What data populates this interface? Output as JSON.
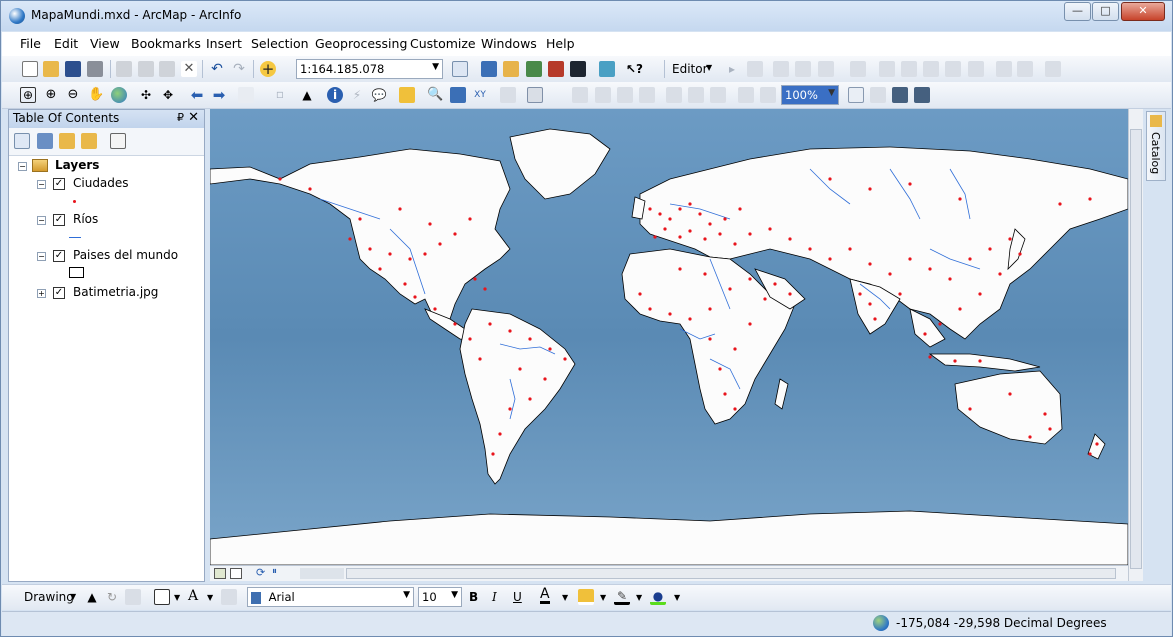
{
  "window": {
    "title": "MapaMundi.mxd - ArcMap - ArcInfo",
    "min": "—",
    "max": "□",
    "close": "✕"
  },
  "menu": [
    "File",
    "Edit",
    "View",
    "Bookmarks",
    "Insert",
    "Selection",
    "Geoprocessing",
    "Customize",
    "Windows",
    "Help"
  ],
  "standard_toolbar": {
    "scale_value": "1:164.185.078",
    "editor_label": "Editor"
  },
  "tools_toolbar": {
    "zoom_percent": "100%"
  },
  "toc": {
    "title": "Table Of Contents",
    "pin": "₽",
    "close": "✕",
    "root": "Layers",
    "layers": [
      {
        "name": "Ciudades",
        "expanded": true,
        "checked": true,
        "symbol": "point-red"
      },
      {
        "name": "Ríos",
        "expanded": true,
        "checked": true,
        "symbol": "line-blue"
      },
      {
        "name": "Paises del mundo",
        "expanded": true,
        "checked": true,
        "symbol": "polygon-white"
      },
      {
        "name": "Batimetria.jpg",
        "expanded": false,
        "checked": true,
        "symbol": "raster"
      }
    ]
  },
  "catalog_tab": "Catalog",
  "drawing_toolbar": {
    "label": "Drawing",
    "font": "Arial",
    "size": "10",
    "bold": "B",
    "italic": "I",
    "underline": "U",
    "font_color_letter": "A"
  },
  "status": {
    "coords": "-175,084  -29,598 Decimal Degrees"
  },
  "colors": {
    "ocean": "#5f8fb8",
    "land": "#fcfcfc",
    "city": "#e8141c",
    "river": "#2f6ed8"
  }
}
